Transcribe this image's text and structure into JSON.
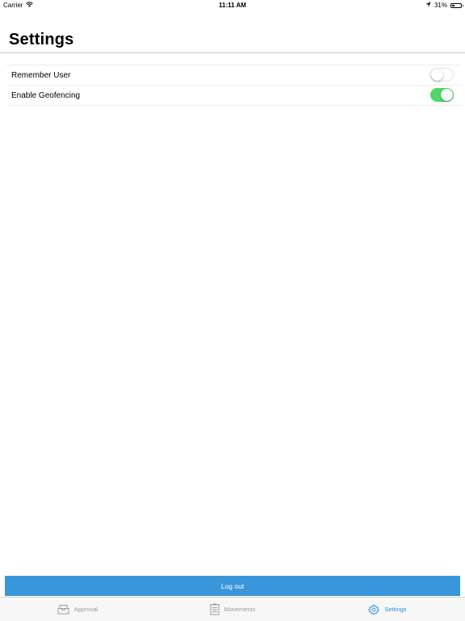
{
  "status_bar": {
    "carrier": "Carrier",
    "time": "11:11 AM",
    "battery": "31%",
    "battery_level": 0.31,
    "icons": [
      "wifi-icon",
      "location-arrow-icon",
      "battery-icon"
    ]
  },
  "nav": {
    "title": "Settings"
  },
  "settings": [
    {
      "label": "Remember User",
      "enabled": false
    },
    {
      "label": "Enable Geofencing",
      "enabled": true
    }
  ],
  "logout_label": "Log out",
  "tabs": [
    {
      "label": "Approval",
      "icon": "inbox-icon",
      "active": false
    },
    {
      "label": "Movements",
      "icon": "clipboard-icon",
      "active": false
    },
    {
      "label": "Settings",
      "icon": "gear-icon",
      "active": true
    }
  ],
  "colors": {
    "accent": "#3a96db",
    "toggle_on": "#4cd964",
    "tab_active": "#2f8fd8",
    "tab_inactive": "#9b9b9b"
  }
}
